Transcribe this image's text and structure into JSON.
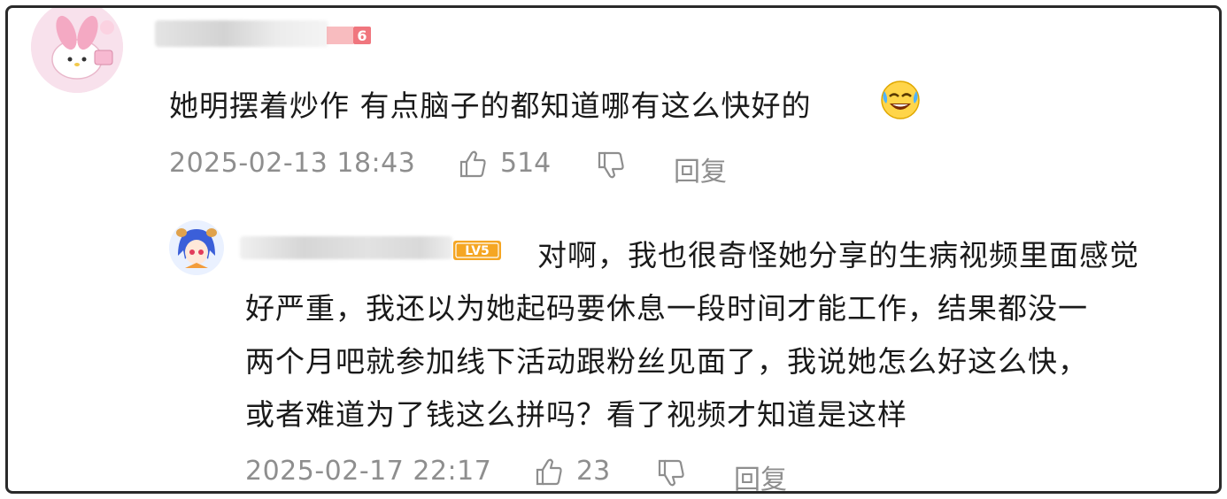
{
  "comment": {
    "text": "她明摆着炒作 有点脑子的都知道哪有这么快好的",
    "level_badge": "6",
    "timestamp": "2025-02-13 18:43",
    "like_count": "514",
    "reply_label": "回复",
    "emoji": "laughing-crying-emoji"
  },
  "reply": {
    "level_badge": "LV5",
    "lines": [
      "对啊，我也很奇怪她分享的生病视频里面感觉",
      "好严重，我还以为她起码要休息一段时间才能工作，结果都没一",
      "两个月吧就参加线下活动跟粉丝见面了，我说她怎么好这么快，",
      "或者难道为了钱这么拼吗？看了视频才知道是这样"
    ],
    "timestamp": "2025-02-17 22:17",
    "like_count": "23",
    "reply_label": "回复"
  },
  "colors": {
    "text": "#1a1a1a",
    "meta": "#8e8e8e",
    "level6_badge": "#f0767e",
    "lv5_badge": "#f5a623",
    "frame_border": "#2a2a2a"
  }
}
